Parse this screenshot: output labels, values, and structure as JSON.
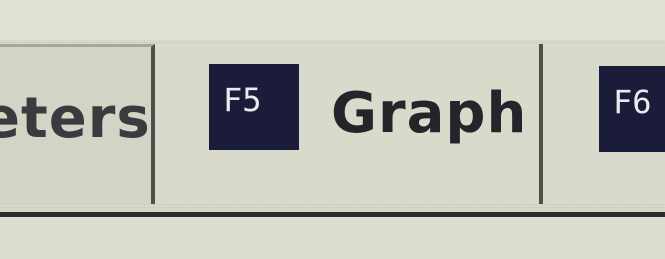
{
  "tabs": [
    {
      "label": "eters",
      "key": ""
    },
    {
      "label": "Graph",
      "key": "F5"
    },
    {
      "label": "",
      "key": "F6"
    }
  ],
  "colors": {
    "background": "#d8dacb",
    "key_cap": "#1b1c3a",
    "text": "#24252a"
  }
}
